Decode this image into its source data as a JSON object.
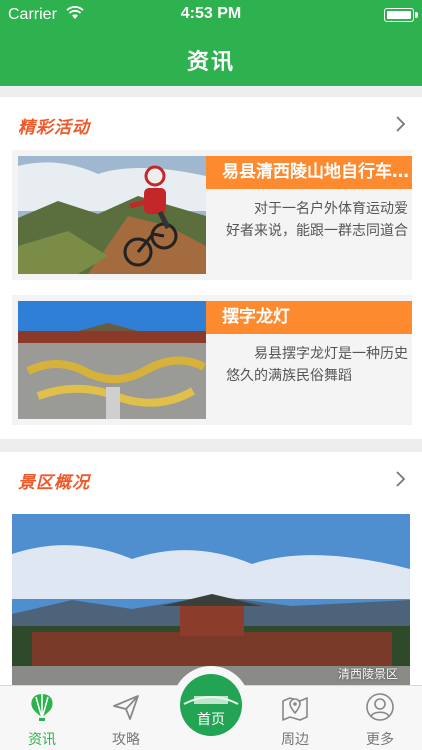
{
  "status_bar": {
    "carrier": "Carrier",
    "time": "4:53 PM"
  },
  "header": {
    "title": "资讯"
  },
  "activities": {
    "title": "精彩活动",
    "items": [
      {
        "title": "易县清西陵山地自行车比赛",
        "desc": "对于一名户外体育运动爱好者来说，能跟一群志同道合的朋友"
      },
      {
        "title": "摆字龙灯",
        "desc": "易县摆字龙灯是一种历史悠久的满族民俗舞蹈"
      }
    ]
  },
  "scenic": {
    "title": "景区概况",
    "watermark": "清西陵景区"
  },
  "tabbar": {
    "tabs": [
      {
        "label": "资讯",
        "icon": "balloon-icon",
        "active": true
      },
      {
        "label": "攻略",
        "icon": "paper-plane-icon",
        "active": false
      },
      {
        "label": "首页",
        "icon": "home-icon",
        "active": false
      },
      {
        "label": "周边",
        "icon": "map-pin-icon",
        "active": false
      },
      {
        "label": "更多",
        "icon": "user-icon",
        "active": false
      }
    ]
  },
  "colors": {
    "brand_green": "#2db24f",
    "accent_orange": "#fe8a2f",
    "section_title": "#ef5a2a"
  }
}
